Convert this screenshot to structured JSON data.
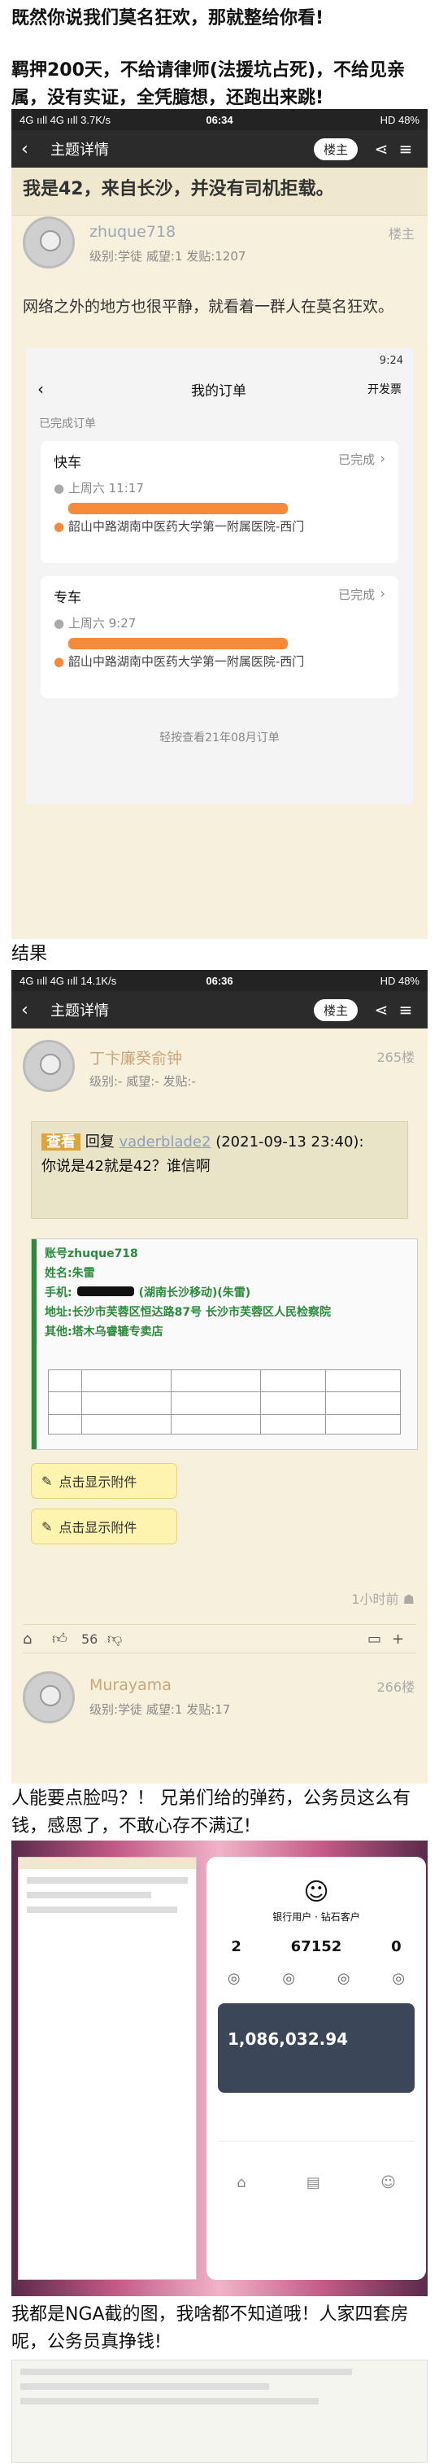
{
  "headline": "既然你说我们莫名狂欢，那就整给你看!",
  "intro": "羁押200天，不给请律师(法援坑占死)，不给见亲属，没有实证，全凭臆想，还跑出来跳!",
  "screen1": {
    "status_left": "4G ııll 4G ııll 3.7K/s",
    "status_time": "06:34",
    "status_right": "HD 48%",
    "nav_title": "主题详情",
    "nav_pill": "楼主",
    "post_title": "我是42，来自长沙，并没有司机拒载。",
    "user": "zhuque718",
    "floor": "楼主",
    "meta": "级别:学徒  威望:1  发贴:1207",
    "body": "网络之外的地方也很平静，就看着一群人在莫名狂欢。",
    "orders": {
      "time": "9:24",
      "title": "我的订单",
      "invoice": "开发票",
      "cancelled": "已完成订单",
      "o1_type": "快车",
      "o1_status": "已完成",
      "o1_time": "上周六 11:17",
      "o1_dest": "韶山中路湖南中医药大学第一附属医院-西门",
      "o2_type": "专车",
      "o2_status": "已完成",
      "o2_time": "上周六 9:27",
      "o2_dest": "韶山中路湖南中医药大学第一附属医院-西门",
      "footer": "轻按查看21年08月订单"
    }
  },
  "result_label": "结果",
  "screen2": {
    "status_left": "4G ııll 4G ııll 14.1K/s",
    "status_time": "06:36",
    "status_right": "HD 48%",
    "nav_title": "主题详情",
    "nav_pill": "楼主",
    "user": "丁卞廉癸俞钟",
    "floor": "265楼",
    "meta": "级别:-  威望:-  发贴:-",
    "quote_tag": "查看",
    "quote_reply": "回复",
    "quote_link": "vaderblade2",
    "quote_time": "(2021-09-13 23:40):",
    "quote_body": "你说是42就是42？谁信啊",
    "doc_account": "账号zhuque718",
    "doc_name": "姓名:朱雷",
    "doc_phone": "手机:",
    "doc_phone_tail": "(湖南长沙移动)(朱雷)",
    "doc_addr": "地址:长沙市芙蓉区恒达路87号 长沙市芙蓉区人民检察院",
    "doc_other": "其他:塔木乌睿辘专卖店",
    "attach1": "点击显示附件",
    "attach2": "点击显示附件",
    "ago": "1小时前",
    "likes": "56",
    "user2": "Murayama",
    "floor2": "266楼",
    "meta2": "级别:学徒  威望:1  发贴:17"
  },
  "text2": "人能要点脸吗？！ 兄弟们给的弹药，公务员这么有钱，感恩了，不敢心存不满辽!",
  "screen3": {
    "followers": "2",
    "coins": "67152",
    "zero": "0",
    "balance": "1,086,032.94",
    "label_a": "银行用户",
    "label_b": "钻石客户"
  },
  "text3": "我都是NGA截的图，我啥都不知道哦！人家四套房呢，公务员真挣钱!"
}
